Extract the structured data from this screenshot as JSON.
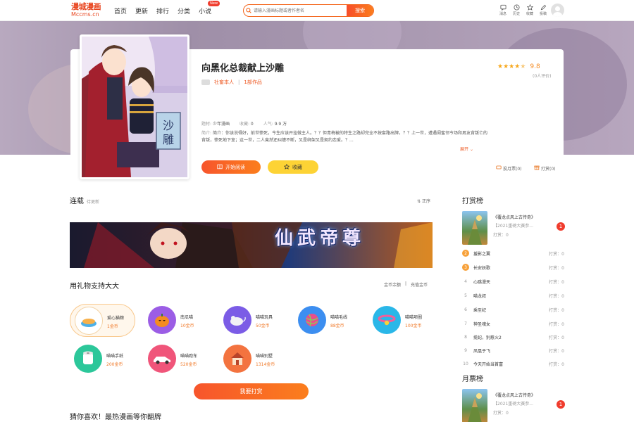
{
  "header": {
    "logo_line1": "漫城漫画",
    "logo_line2": "Mccms.cn",
    "nav": [
      {
        "label": "首页"
      },
      {
        "label": "更新"
      },
      {
        "label": "排行"
      },
      {
        "label": "分类"
      },
      {
        "label": "小说",
        "badge": "New"
      }
    ],
    "search": {
      "placeholder": "请输入漫画标题或者作者名",
      "button": "搜索"
    },
    "tools": [
      {
        "label": "消息",
        "icon": "message-icon"
      },
      {
        "label": "历史",
        "icon": "history-icon"
      },
      {
        "label": "收藏",
        "icon": "star-icon"
      },
      {
        "label": "投稿",
        "icon": "pen-icon"
      }
    ]
  },
  "comic": {
    "title": "向黑化总裁献上沙雕",
    "author": "社畜本人",
    "works": "1部作品",
    "score": "9.8",
    "rating_count": "(0人评价)",
    "stars": 4.5,
    "type_label": "题材:",
    "type_value": "少年漫画",
    "fav_label": "收藏:",
    "fav_value": "0",
    "pop_label": "人气:",
    "pop_value": "9.9 万",
    "intro_label": "简介:",
    "intro": "简介：你该说得好，前世惨死，今生应该开挂做主人。？？但青梅被的特生之路却完全不按套路出牌。？？上一世，遭遇闺蜜邻今场和男友背叛亡的背叛，惨死地下室；这一世，二人竟然还纠缠不断，又是绑架又是契约恋爱。？...",
    "expand": "展开",
    "cover_text": "沙雕",
    "read_button": "开始阅读",
    "fav_button": "收藏",
    "vote_link": "投月票(0)",
    "tip_link": "打赏(0)"
  },
  "chapters": {
    "title": "连载",
    "subtitle": "待更新",
    "order": "正序",
    "banner_text": "仙武帝尊"
  },
  "gifts": {
    "title": "用礼物支持大大",
    "balance_link": "金币余额",
    "recharge_link": "充值金币",
    "items": [
      {
        "name": "爱心猫粮",
        "price": "1金币",
        "icon": "cat-food-icon",
        "color": "#fff3df"
      },
      {
        "name": "南瓜喵",
        "price": "10金币",
        "icon": "pumpkin-icon",
        "color": "#9b5de5"
      },
      {
        "name": "喵喵玩具",
        "price": "50金币",
        "icon": "mouse-toy-icon",
        "color": "#7b5ce6"
      },
      {
        "name": "喵喵毛线",
        "price": "88金币",
        "icon": "yarn-ball-icon",
        "color": "#3c8ef0"
      },
      {
        "name": "喵喵项圈",
        "price": "100金币",
        "icon": "collar-icon",
        "color": "#2ab7e8"
      },
      {
        "name": "喵喵手纸",
        "price": "200金币",
        "icon": "toilet-paper-icon",
        "color": "#2cc79a"
      },
      {
        "name": "喵喵跑车",
        "price": "520金币",
        "icon": "car-icon",
        "color": "#f0557a"
      },
      {
        "name": "喵喵别墅",
        "price": "1314金币",
        "icon": "house-icon",
        "color": "#f3733f"
      }
    ],
    "submit": "我要打赏"
  },
  "guess": {
    "title": "猜你喜欢！最热漫画等你翻牌"
  },
  "tip_rank": {
    "title": "打赏榜",
    "feature": {
      "title": "《覆龙点风上古传奇》",
      "subtitle": "【2021重磅大赛参...",
      "count": "打赏：0",
      "rank": "1"
    },
    "rows": [
      {
        "rank": "2",
        "name": "援影之翼",
        "count": "打赏：0"
      },
      {
        "rank": "3",
        "name": "长安妖歌",
        "count": "打赏：0"
      },
      {
        "rank": "4",
        "name": "心跳漫天",
        "count": "打赏：0"
      },
      {
        "rank": "5",
        "name": "喵龙叔",
        "count": "打赏：0"
      },
      {
        "rank": "6",
        "name": "乘至纪",
        "count": "打赏：0"
      },
      {
        "rank": "7",
        "name": "神圣魂女",
        "count": "打赏：0"
      },
      {
        "rank": "8",
        "name": "揽妃，别惹火2",
        "count": "打赏：0"
      },
      {
        "rank": "9",
        "name": "凤凰于飞",
        "count": "打赏：0"
      },
      {
        "rank": "10",
        "name": "今天开始当首富",
        "count": "打赏：0"
      }
    ]
  },
  "vote_rank": {
    "title": "月票榜",
    "feature": {
      "title": "《覆龙点风上古传奇》",
      "subtitle": "【2021重磅大赛参...",
      "count": "打赏：0",
      "rank": "1"
    }
  }
}
